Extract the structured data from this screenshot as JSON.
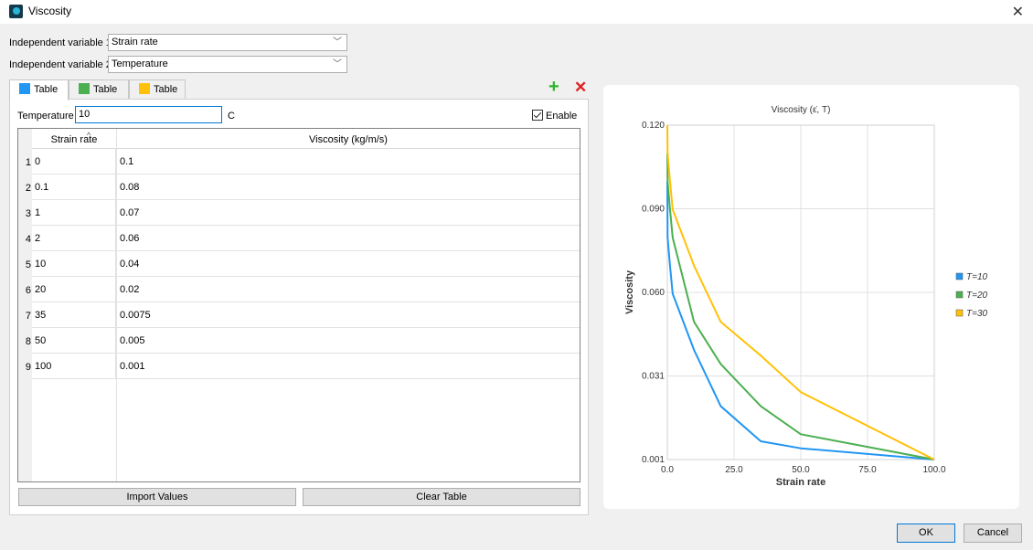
{
  "window": {
    "title": "Viscosity",
    "close_glyph": "✕"
  },
  "fields": {
    "var1_label": "Independent variable 1",
    "var1_value": "Strain rate",
    "var2_label": "Independent variable 2",
    "var2_value": "Temperature"
  },
  "tabs": [
    {
      "label": "Table",
      "color": "#2196f3"
    },
    {
      "label": "Table",
      "color": "#4caf50"
    },
    {
      "label": "Table",
      "color": "#ffc107"
    }
  ],
  "toolbar": {
    "add_glyph": "+",
    "remove_glyph": "✕"
  },
  "temperature": {
    "label": "Temperature",
    "value": "10",
    "unit": "C"
  },
  "enable_label": "Enable",
  "table": {
    "headers": [
      "Strain rate",
      "Viscosity (kg/m/s)"
    ],
    "rows": [
      [
        "1",
        "0",
        "0.1"
      ],
      [
        "2",
        "0.1",
        "0.08"
      ],
      [
        "3",
        "1",
        "0.07"
      ],
      [
        "4",
        "2",
        "0.06"
      ],
      [
        "5",
        "10",
        "0.04"
      ],
      [
        "6",
        "20",
        "0.02"
      ],
      [
        "7",
        "35",
        "0.0075"
      ],
      [
        "8",
        "50",
        "0.005"
      ],
      [
        "9",
        "100",
        "0.001"
      ]
    ]
  },
  "buttons": {
    "import": "Import Values",
    "clear": "Clear Table",
    "ok": "OK",
    "cancel": "Cancel"
  },
  "chart_data": {
    "type": "line",
    "title": "Viscosity (ε̇, T)",
    "xlabel": "Strain rate",
    "ylabel": "Viscosity",
    "xlim": [
      0,
      100
    ],
    "ylim": [
      0.001,
      0.12
    ],
    "xticks": [
      "0.0",
      "25.0",
      "50.0",
      "75.0",
      "100.0"
    ],
    "yticks": [
      "0.001",
      "0.031",
      "0.060",
      "0.090",
      "0.120"
    ],
    "grid": true,
    "legend_position": "right",
    "series": [
      {
        "name": "T=10",
        "color": "#2196f3",
        "x": [
          0,
          0.1,
          1,
          2,
          10,
          20,
          35,
          50,
          100
        ],
        "y": [
          0.1,
          0.08,
          0.07,
          0.06,
          0.04,
          0.02,
          0.0075,
          0.005,
          0.001
        ]
      },
      {
        "name": "T=20",
        "color": "#4caf50",
        "x": [
          0,
          0.1,
          1,
          2,
          10,
          20,
          35,
          50,
          100
        ],
        "y": [
          0.11,
          0.1,
          0.09,
          0.08,
          0.05,
          0.035,
          0.02,
          0.01,
          0.001
        ]
      },
      {
        "name": "T=30",
        "color": "#ffc107",
        "x": [
          0,
          0.1,
          1,
          2,
          10,
          20,
          35,
          50,
          100
        ],
        "y": [
          0.12,
          0.11,
          0.1,
          0.09,
          0.07,
          0.05,
          0.038,
          0.025,
          0.001
        ]
      }
    ]
  }
}
